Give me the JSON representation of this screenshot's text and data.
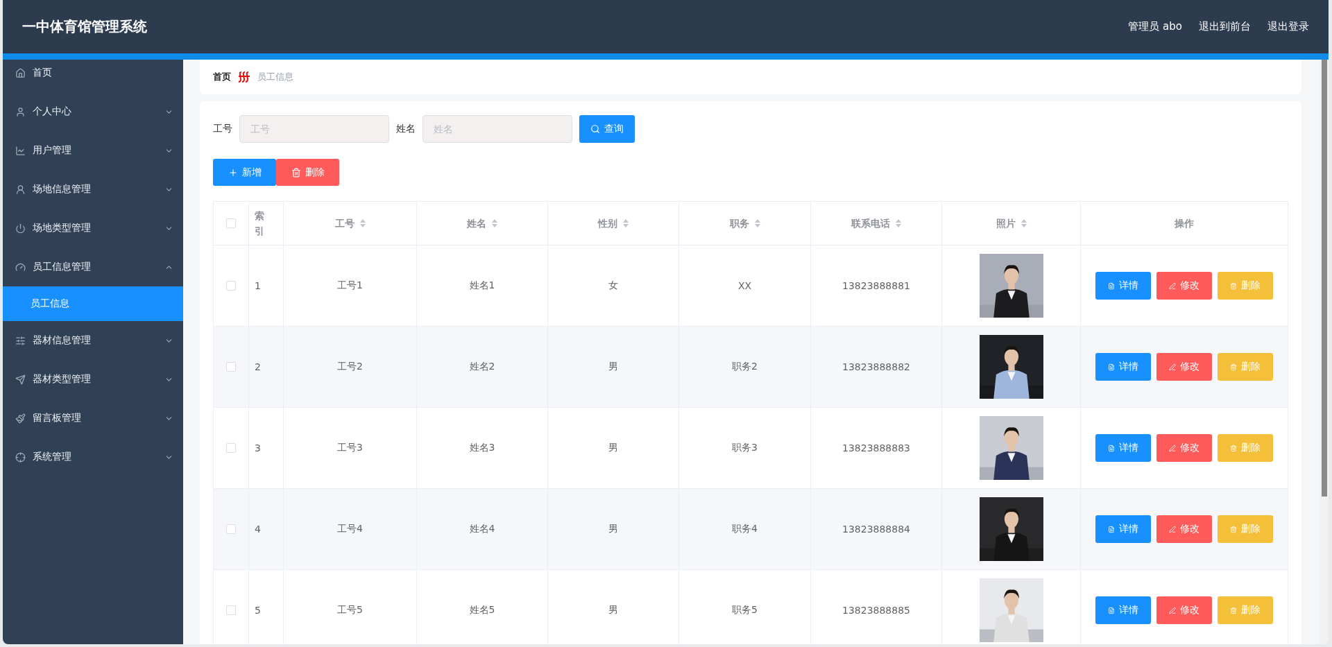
{
  "header": {
    "title": "一中体育馆管理系统",
    "links": [
      "管理员 abo",
      "退出到前台",
      "退出登录"
    ]
  },
  "sidebar": {
    "items": [
      {
        "kind": "link",
        "label": "首页",
        "selected": false
      },
      {
        "kind": "submenu",
        "label": "个人中心",
        "selected": false,
        "expanded": false
      },
      {
        "kind": "submenu",
        "label": "用户管理",
        "selected": false,
        "expanded": false
      },
      {
        "kind": "submenu",
        "label": "场地信息管理",
        "selected": false,
        "expanded": false
      },
      {
        "kind": "submenu",
        "label": "场地类型管理",
        "selected": false,
        "expanded": false
      },
      {
        "kind": "submenu",
        "label": "员工信息管理",
        "selected": false,
        "expanded": true,
        "children": [
          {
            "label": "员工信息",
            "selected": true
          }
        ]
      },
      {
        "kind": "submenu",
        "label": "器材信息管理",
        "selected": false,
        "expanded": false
      },
      {
        "kind": "submenu",
        "label": "器材类型管理",
        "selected": false,
        "expanded": false
      },
      {
        "kind": "submenu",
        "label": "留言板管理",
        "selected": false,
        "expanded": false
      },
      {
        "kind": "submenu",
        "label": "系统管理",
        "selected": false,
        "expanded": false
      }
    ]
  },
  "breadcrumb": [
    "首页",
    "员工信息"
  ],
  "search": {
    "fields": [
      {
        "label": "工号",
        "placeholder": "工号"
      },
      {
        "label": "姓名",
        "placeholder": "姓名"
      }
    ],
    "button": "查询"
  },
  "actions": [
    {
      "kind": "add",
      "label": "新增"
    },
    {
      "kind": "delete",
      "label": "删除"
    }
  ],
  "table": {
    "select_all_checked": false,
    "columns": [
      {
        "label": "索引",
        "sortable": false
      },
      {
        "label": "工号",
        "sortable": true
      },
      {
        "label": "姓名",
        "sortable": true
      },
      {
        "label": "性别",
        "sortable": true
      },
      {
        "label": "职务",
        "sortable": true
      },
      {
        "label": "联系电话",
        "sortable": true
      },
      {
        "label": "照片",
        "sortable": true
      },
      {
        "label": "操作",
        "sortable": false
      }
    ],
    "rows": [
      {
        "checked": false,
        "index": "1",
        "id": "工号1",
        "name": "姓名1",
        "gender": "女",
        "position": "XX",
        "phone": "13823888881",
        "buttons": [
          {
            "kind": "detail",
            "label": "详情"
          },
          {
            "kind": "edit",
            "label": "修改"
          },
          {
            "kind": "delete",
            "label": "删除"
          }
        ]
      },
      {
        "checked": false,
        "index": "2",
        "id": "工号2",
        "name": "姓名2",
        "gender": "男",
        "position": "职务2",
        "phone": "13823888882",
        "buttons": [
          {
            "kind": "detail",
            "label": "详情"
          },
          {
            "kind": "edit",
            "label": "修改"
          },
          {
            "kind": "delete",
            "label": "删除"
          }
        ]
      },
      {
        "checked": false,
        "index": "3",
        "id": "工号3",
        "name": "姓名3",
        "gender": "男",
        "position": "职务3",
        "phone": "13823888883",
        "buttons": [
          {
            "kind": "detail",
            "label": "详情"
          },
          {
            "kind": "edit",
            "label": "修改"
          },
          {
            "kind": "delete",
            "label": "删除"
          }
        ]
      },
      {
        "checked": false,
        "index": "4",
        "id": "工号4",
        "name": "姓名4",
        "gender": "男",
        "position": "职务4",
        "phone": "13823888884",
        "buttons": [
          {
            "kind": "detail",
            "label": "详情"
          },
          {
            "kind": "edit",
            "label": "修改"
          },
          {
            "kind": "delete",
            "label": "删除"
          }
        ]
      },
      {
        "checked": false,
        "index": "5",
        "id": "工号5",
        "name": "姓名5",
        "gender": "男",
        "position": "职务5",
        "phone": "13823888885",
        "buttons": [
          {
            "kind": "detail",
            "label": "详情"
          },
          {
            "kind": "edit",
            "label": "修改"
          },
          {
            "kind": "delete",
            "label": "删除"
          }
        ]
      }
    ]
  }
}
